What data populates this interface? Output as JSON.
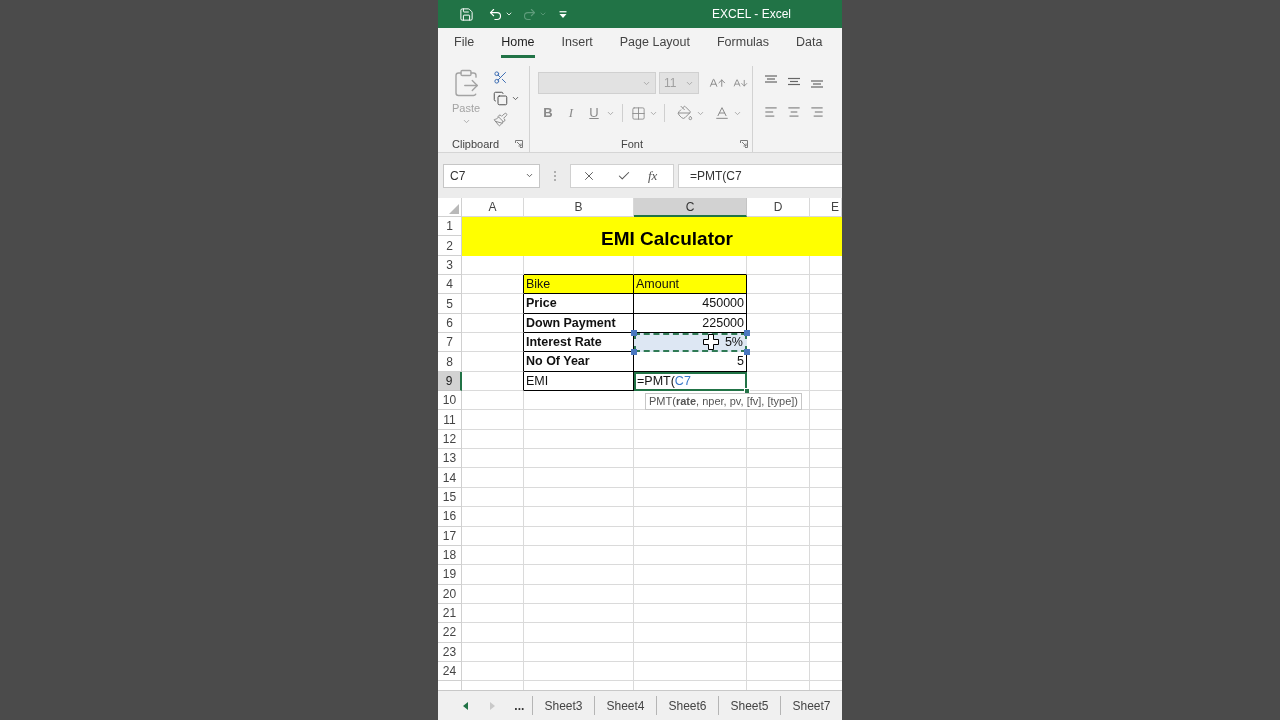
{
  "window": {
    "title": "EXCEL - Excel"
  },
  "quick_access": {
    "undo": {
      "disabled": false
    },
    "redo": {
      "disabled": true
    }
  },
  "ribbon_tabs": [
    {
      "label": "File",
      "selected": false
    },
    {
      "label": "Home",
      "selected": true
    },
    {
      "label": "Insert",
      "selected": false
    },
    {
      "label": "Page Layout",
      "selected": false
    },
    {
      "label": "Formulas",
      "selected": false
    },
    {
      "label": "Data",
      "selected": false
    }
  ],
  "clipboard_group": {
    "label": "Clipboard",
    "paste": {
      "label": "Paste",
      "disabled": true
    }
  },
  "font_group": {
    "label": "Font",
    "font_name": {
      "disabled": true
    },
    "font_size": {
      "value": "11",
      "disabled": true
    },
    "style_buttons": [
      {
        "kind": "bold",
        "label": "B"
      },
      {
        "kind": "italic",
        "label": "I"
      },
      {
        "kind": "underline",
        "label": "U"
      }
    ]
  },
  "name_box": {
    "value": "C7"
  },
  "formula_bar": {
    "function_label": "fx",
    "value": "=PMT(C7"
  },
  "columns": [
    {
      "label": "A",
      "selected": false
    },
    {
      "label": "B",
      "selected": false
    },
    {
      "label": "C",
      "selected": true
    },
    {
      "label": "D",
      "selected": false
    },
    {
      "label": "E",
      "selected": false
    }
  ],
  "rows": [
    {
      "label": "1",
      "selected": false
    },
    {
      "label": "2",
      "selected": false
    },
    {
      "label": "3",
      "selected": false
    },
    {
      "label": "4",
      "selected": false
    },
    {
      "label": "5",
      "selected": false
    },
    {
      "label": "6",
      "selected": false
    },
    {
      "label": "7",
      "selected": false
    },
    {
      "label": "8",
      "selected": false
    },
    {
      "label": "9",
      "selected": true
    },
    {
      "label": "10",
      "selected": false
    },
    {
      "label": "11",
      "selected": false
    },
    {
      "label": "12",
      "selected": false
    },
    {
      "label": "13",
      "selected": false
    },
    {
      "label": "14",
      "selected": false
    },
    {
      "label": "15",
      "selected": false
    },
    {
      "label": "16",
      "selected": false
    },
    {
      "label": "17",
      "selected": false
    },
    {
      "label": "18",
      "selected": false
    },
    {
      "label": "19",
      "selected": false
    },
    {
      "label": "20",
      "selected": false
    },
    {
      "label": "21",
      "selected": false
    },
    {
      "label": "22",
      "selected": false
    },
    {
      "label": "23",
      "selected": false
    },
    {
      "label": "24",
      "selected": false
    }
  ],
  "title_cell": "EMI Calculator",
  "table": {
    "header": [
      "Bike",
      "Amount"
    ],
    "rows": [
      {
        "label": "Price",
        "value": "450000",
        "bold": true,
        "referenced": false,
        "active": false
      },
      {
        "label": "Down Payment",
        "value": "225000",
        "bold": true,
        "referenced": false,
        "active": false
      },
      {
        "label": "Interest Rate",
        "value": "5%",
        "bold": true,
        "referenced": true,
        "active": false
      },
      {
        "label": "No Of Year",
        "value": "5",
        "bold": true,
        "referenced": false,
        "active": false
      },
      {
        "label": "EMI",
        "bold": false,
        "referenced": false,
        "active": true,
        "editing": {
          "text": "=PMT(",
          "reference": "C7"
        }
      }
    ]
  },
  "tooltip": "PMT(**rate**, nper, pv, [fv], [type])",
  "sheet_nav": [
    {
      "kind": "previous",
      "disabled": false
    },
    {
      "kind": "next",
      "disabled": true
    }
  ],
  "sheet_tabs": {
    "more": "...",
    "tabs": [
      {
        "label": "Sheet3",
        "selected": false
      },
      {
        "label": "Sheet4",
        "selected": false
      },
      {
        "label": "Sheet6",
        "selected": false
      },
      {
        "label": "Sheet5",
        "selected": false
      },
      {
        "label": "Sheet7",
        "selected": false
      }
    ]
  }
}
